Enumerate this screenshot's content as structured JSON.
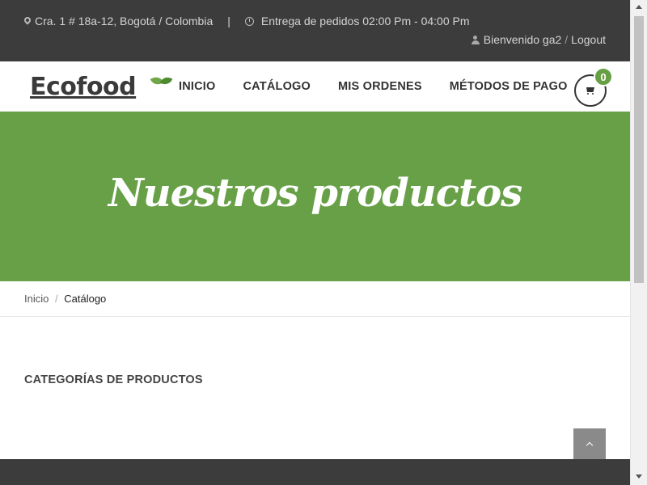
{
  "topbar": {
    "address": "Cra. 1 # 18a-12, Bogotá / Colombia",
    "separator": "|",
    "delivery": "Entrega de pedidos 02:00 Pm - 04:00 Pm",
    "welcome": "Bienvenido ga2",
    "slash": "/",
    "logout": "Logout",
    "icons": [
      "map-marker-icon",
      "clock-icon",
      "user-icon"
    ]
  },
  "header": {
    "logo_text": "Ecofood",
    "nav": [
      "INICIO",
      "CATÁLOGO",
      "MIS ORDENES",
      "MÉTODOS DE PAGO"
    ],
    "cart_count": "0"
  },
  "banner": {
    "title": "Nuestros productos",
    "color": "#67a046"
  },
  "breadcrumb": {
    "home": "Inicio",
    "divider": "/",
    "current": "Catálogo"
  },
  "main": {
    "section_title": "CATEGORÍAS DE PRODUCTOS"
  },
  "colors": {
    "topbar": "#3c3c3c",
    "accent": "#67a046",
    "footer": "#3c3c3c"
  }
}
